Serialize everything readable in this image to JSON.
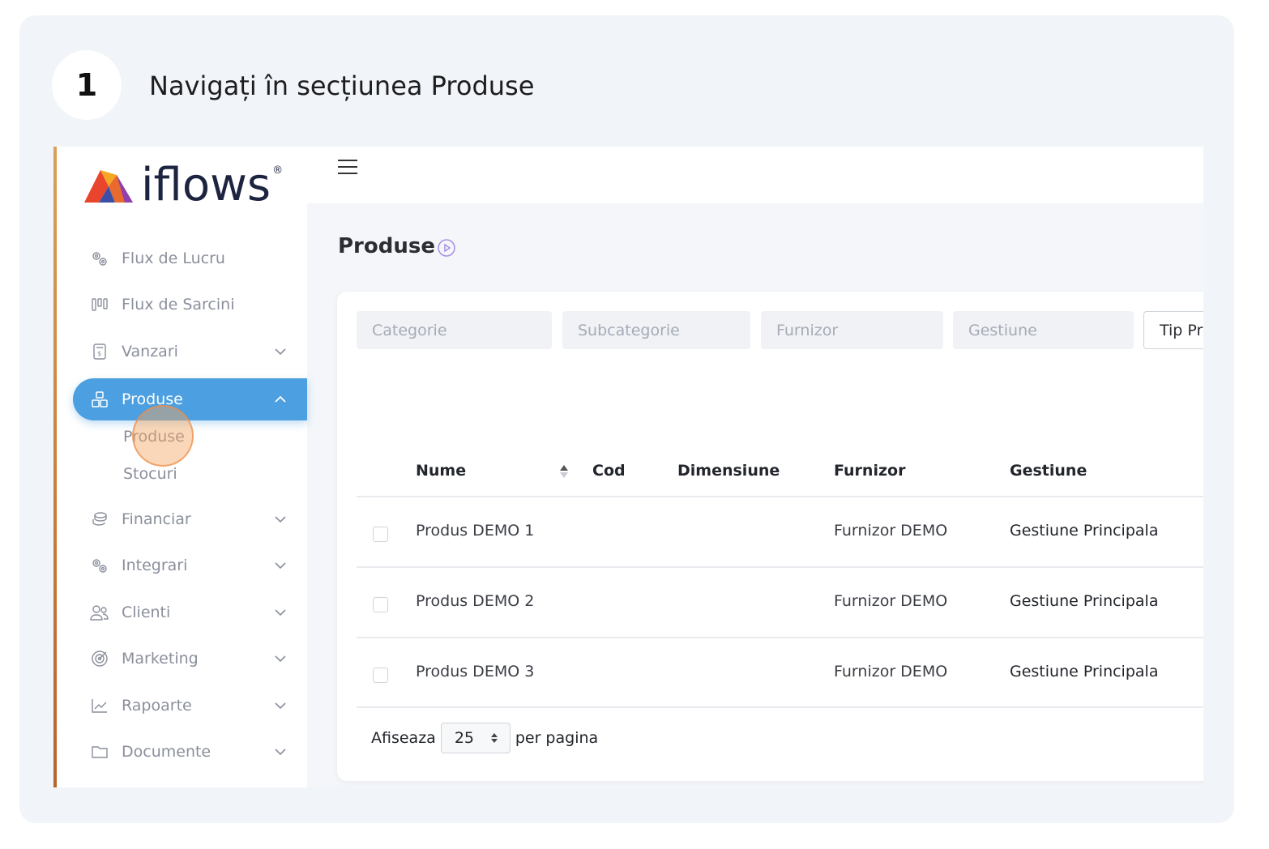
{
  "step": {
    "number": "1",
    "title": "Navigați în secțiunea Produse"
  },
  "app": {
    "logo_text": "iflows",
    "logo_mark": "®",
    "accent_color": "#4c9fe0"
  },
  "sidebar": {
    "items": [
      {
        "label": "Flux de Lucru",
        "icon": "gears-icon"
      },
      {
        "label": "Flux de Sarcini",
        "icon": "kanban-icon"
      },
      {
        "label": "Vanzari",
        "icon": "receipt-icon"
      },
      {
        "label": "Produse",
        "icon": "boxes-icon"
      },
      {
        "label": "Financiar",
        "icon": "coins-icon"
      },
      {
        "label": "Integrari",
        "icon": "gears-icon"
      },
      {
        "label": "Clienti",
        "icon": "users-icon"
      },
      {
        "label": "Marketing",
        "icon": "target-icon"
      },
      {
        "label": "Rapoarte",
        "icon": "chart-icon"
      },
      {
        "label": "Documente",
        "icon": "folder-icon"
      }
    ],
    "sub_items": [
      "Produse",
      "Stocuri"
    ]
  },
  "page": {
    "title": "Produse"
  },
  "filters": [
    "Categorie",
    "Subcategorie",
    "Furnizor",
    "Gestiune",
    "Tip Pr"
  ],
  "table": {
    "columns": [
      "Nume",
      "Cod",
      "Dimensiune",
      "Furnizor",
      "Gestiune"
    ],
    "rows": [
      {
        "nume": "Produs DEMO 1",
        "cod": "",
        "dimensiune": "",
        "furnizor": "Furnizor DEMO",
        "gestiune": "Gestiune Principala"
      },
      {
        "nume": "Produs DEMO 2",
        "cod": "",
        "dimensiune": "",
        "furnizor": "Furnizor DEMO",
        "gestiune": "Gestiune Principala"
      },
      {
        "nume": "Produs DEMO 3",
        "cod": "",
        "dimensiune": "",
        "furnizor": "Furnizor DEMO",
        "gestiune": "Gestiune Principala"
      }
    ]
  },
  "pagination": {
    "prefix": "Afiseaza",
    "value": "25",
    "suffix": "per pagina"
  }
}
